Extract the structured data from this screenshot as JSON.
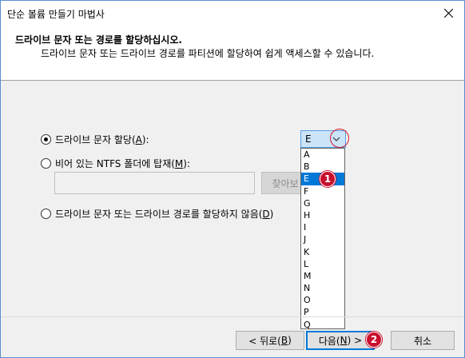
{
  "window": {
    "title": "단순 볼륨 만들기 마법사"
  },
  "header": {
    "title": "드라이브 문자 또는 경로를 할당하십시오.",
    "subtitle": "드라이브 문자 또는 드라이브 경로를 파티션에 할당하여 쉽게 액세스할 수 있습니다."
  },
  "options": {
    "assign_letter": {
      "label": "드라이브 문자 할당(",
      "hotkey": "A",
      "suffix": "):",
      "checked": true
    },
    "mount_ntfs": {
      "label": "비어 있는 NTFS 폴더에 탑재(",
      "hotkey": "M",
      "suffix": "):",
      "checked": false
    },
    "no_assign": {
      "label": "드라이브 문자 또는 드라이브 경로를 할당하지 않음(",
      "hotkey": "D",
      "suffix": ")",
      "checked": false
    }
  },
  "browse_button": {
    "label": "찾아보"
  },
  "drive_select": {
    "value": "E",
    "options": [
      "A",
      "B",
      "E",
      "F",
      "G",
      "H",
      "I",
      "J",
      "K",
      "L",
      "M",
      "N",
      "O",
      "P",
      "Q"
    ],
    "selected_index": 2
  },
  "annotations": {
    "badge1": "1",
    "badge2": "2",
    "accent": "#c8102e"
  },
  "footer": {
    "back": {
      "label": "< 뒤로(",
      "hotkey": "B",
      "suffix": ")"
    },
    "next": {
      "label": "다음(",
      "hotkey": "N",
      "suffix": ") >"
    },
    "cancel": {
      "label": "취소"
    }
  }
}
